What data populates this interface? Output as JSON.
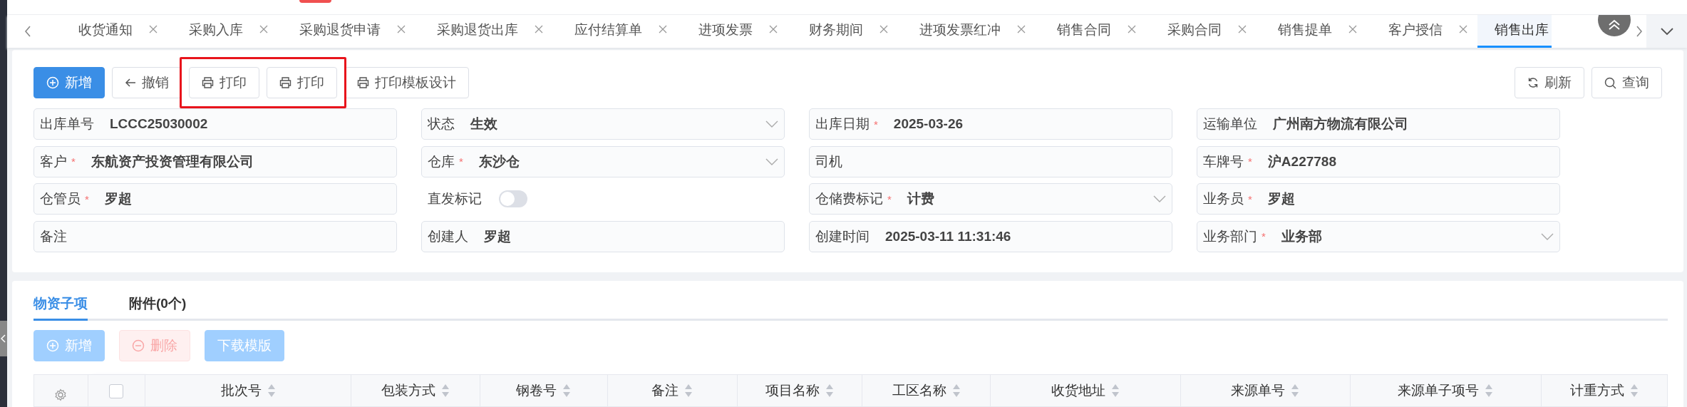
{
  "tabs": [
    {
      "label": "收货通知",
      "selected": false
    },
    {
      "label": "采购入库",
      "selected": false
    },
    {
      "label": "采购退货申请",
      "selected": false
    },
    {
      "label": "采购退货出库",
      "selected": false
    },
    {
      "label": "应付结算单",
      "selected": false
    },
    {
      "label": "进项发票",
      "selected": false
    },
    {
      "label": "财务期间",
      "selected": false
    },
    {
      "label": "进项发票红冲",
      "selected": false
    },
    {
      "label": "销售合同",
      "selected": false
    },
    {
      "label": "采购合同",
      "selected": false
    },
    {
      "label": "销售提单",
      "selected": false
    },
    {
      "label": "客户授信",
      "selected": false
    },
    {
      "label": "销售出库",
      "selected": true
    }
  ],
  "toolbar": {
    "left": [
      {
        "label": "新增",
        "kind": "add",
        "highlighted": false
      },
      {
        "label": "撤销",
        "kind": "undo",
        "highlighted": false
      },
      {
        "label": "打印",
        "kind": "print",
        "highlighted": true
      },
      {
        "label": "打印",
        "kind": "print",
        "highlighted": true
      },
      {
        "label": "打印模板设计",
        "kind": "print",
        "highlighted": false
      }
    ],
    "right": [
      {
        "label": "刷新",
        "kind": "refresh"
      },
      {
        "label": "查询",
        "kind": "search"
      }
    ]
  },
  "form": [
    {
      "label": "出库单号",
      "kind": "text",
      "value": "LCCC25030002"
    },
    {
      "label": "状态",
      "kind": "select",
      "value": "生效"
    },
    {
      "label": "出库日期",
      "required_mark": "*",
      "kind": "text",
      "value": "2025-03-26"
    },
    {
      "label": "运输单位",
      "kind": "text",
      "value": "广州南方物流有限公司"
    },
    {
      "label": "客户",
      "required_mark": "*",
      "kind": "text",
      "value": "东航资产投资管理有限公司"
    },
    {
      "label": "仓库",
      "required_mark": "*",
      "kind": "select",
      "value": "东沙仓"
    },
    {
      "label": "司机",
      "kind": "text"
    },
    {
      "label": "车牌号",
      "required_mark": "*",
      "kind": "text",
      "value": "沪A227788"
    },
    {
      "label": "仓管员",
      "required_mark": "*",
      "kind": "text",
      "value": "罗超"
    },
    {
      "label": "直发标记",
      "kind": "switch",
      "on": false
    },
    {
      "label": "仓储费标记",
      "required_mark": "*",
      "kind": "select",
      "value": "计费"
    },
    {
      "label": "业务员",
      "required_mark": "*",
      "kind": "text",
      "value": "罗超"
    },
    {
      "label": "备注",
      "kind": "text"
    },
    {
      "label": "创建人",
      "kind": "text",
      "value": "罗超"
    },
    {
      "label": "创建时间",
      "kind": "text",
      "value": "2025-03-11 11:31:46"
    },
    {
      "label": "业务部门",
      "required_mark": "*",
      "kind": "select",
      "value": "业务部"
    }
  ],
  "detail": {
    "tabs": [
      {
        "label": "物资子项",
        "selected": true
      },
      {
        "label": "附件(0个)",
        "selected": false
      }
    ],
    "buttons": [
      {
        "label": "新增",
        "kind": "add",
        "disabled": true
      },
      {
        "label": "删除",
        "kind": "delete",
        "disabled": true
      },
      {
        "label": "下载模版",
        "kind": "download",
        "disabled": true
      }
    ],
    "table": {
      "columns": [
        {
          "label": "批次号"
        },
        {
          "label": "包装方式"
        },
        {
          "label": "钢卷号"
        },
        {
          "label": "备注"
        },
        {
          "label": "项目名称"
        },
        {
          "label": "工区名称"
        },
        {
          "label": "收货地址"
        },
        {
          "label": "来源单号"
        },
        {
          "label": "来源单子项号"
        },
        {
          "label": "计重方式"
        }
      ],
      "select_all": {
        "checked": false
      }
    }
  }
}
